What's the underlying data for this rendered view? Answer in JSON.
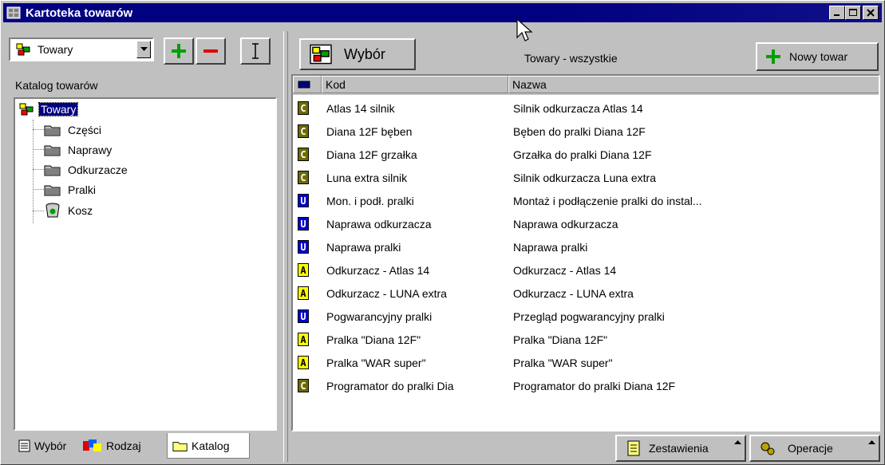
{
  "window": {
    "title": "Kartoteka towarów"
  },
  "left": {
    "combo_value": "Towary",
    "catalog_label": "Katalog towarów",
    "tree": [
      {
        "label": "Towary",
        "selected": true,
        "icon": "goods-root-icon"
      },
      {
        "label": "Części",
        "icon": "folder-icon"
      },
      {
        "label": "Naprawy",
        "icon": "folder-icon"
      },
      {
        "label": "Odkurzacze",
        "icon": "folder-icon"
      },
      {
        "label": "Pralki",
        "icon": "folder-icon"
      },
      {
        "label": "Kosz",
        "icon": "recycle-bin-icon"
      }
    ],
    "tabs": [
      {
        "label": "Wybór",
        "icon": "list-icon"
      },
      {
        "label": "Rodzaj",
        "icon": "shapes-icon"
      },
      {
        "label": "Katalog",
        "icon": "folder-icon",
        "active": true
      }
    ]
  },
  "right": {
    "wybor_label": "Wybór",
    "filter_label": "Towary - wszystkie",
    "new_item_label": "Nowy towar",
    "columns": {
      "kod": "Kod",
      "nazwa": "Nazwa"
    },
    "rows": [
      {
        "type": "C",
        "kod": "Atlas 14 silnik",
        "nazwa": "Silnik odkurzacza Atlas 14"
      },
      {
        "type": "C",
        "kod": "Diana 12F bęben",
        "nazwa": "Bęben do pralki Diana 12F"
      },
      {
        "type": "C",
        "kod": "Diana 12F grzałka",
        "nazwa": "Grzałka do pralki Diana 12F"
      },
      {
        "type": "C",
        "kod": "Luna extra silnik",
        "nazwa": "Silnik odkurzacza Luna extra"
      },
      {
        "type": "U",
        "kod": "Mon. i podł. pralki",
        "nazwa": "Montaż i podłączenie pralki do instal..."
      },
      {
        "type": "U",
        "kod": "Naprawa odkurzacza",
        "nazwa": "Naprawa odkurzacza"
      },
      {
        "type": "U",
        "kod": "Naprawa pralki",
        "nazwa": "Naprawa pralki"
      },
      {
        "type": "A",
        "kod": "Odkurzacz - Atlas 14",
        "nazwa": "Odkurzacz - Atlas 14"
      },
      {
        "type": "A",
        "kod": "Odkurzacz - LUNA extra",
        "nazwa": "Odkurzacz - LUNA extra"
      },
      {
        "type": "U",
        "kod": "Pogwarancyjny pralki",
        "nazwa": "Przegląd pogwarancyjny pralki"
      },
      {
        "type": "A",
        "kod": "Pralka \"Diana 12F\"",
        "nazwa": "Pralka \"Diana 12F\""
      },
      {
        "type": "A",
        "kod": "Pralka \"WAR super\"",
        "nazwa": "Pralka \"WAR super\""
      },
      {
        "type": "C",
        "kod": "Programator do pralki Dia",
        "nazwa": "Programator do pralki Diana 12F"
      }
    ],
    "zestawienia_label": "Zestawienia",
    "operacje_label": "Operacje"
  },
  "colors": {
    "titlebar": "#000080",
    "face": "#c0c0c0",
    "badge_C": "#6b6b00",
    "badge_U": "#0000d0",
    "badge_A": "#ffff00"
  }
}
